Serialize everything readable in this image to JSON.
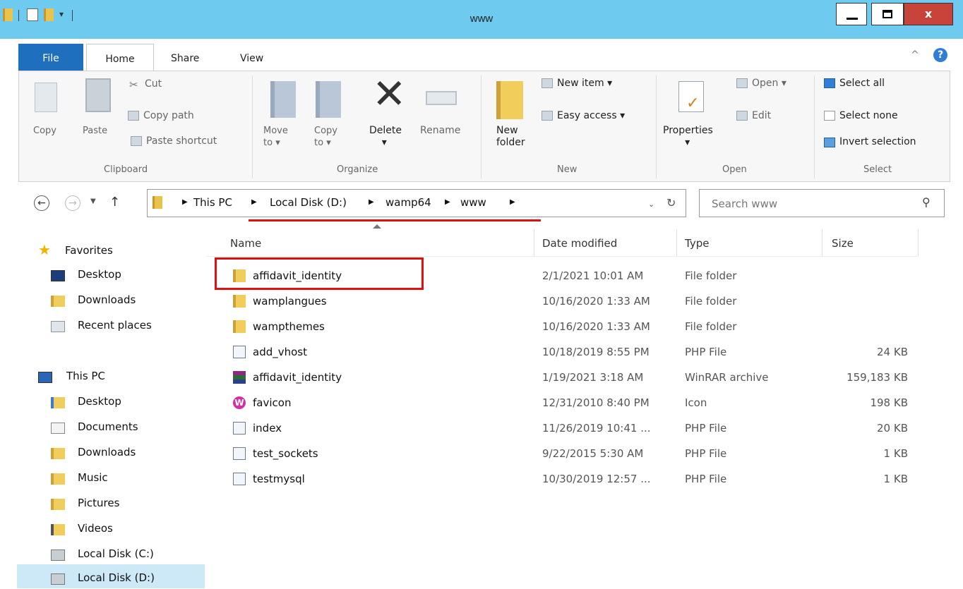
{
  "window": {
    "title": "www"
  },
  "title_controls": {
    "close": "x"
  },
  "tabs": [
    {
      "label": "File"
    },
    {
      "label": "Home"
    },
    {
      "label": "Share"
    },
    {
      "label": "View"
    }
  ],
  "ribbon": {
    "help_caret": "^",
    "help_icon": "?",
    "clipboard": {
      "label": "Clipboard",
      "copy": "Copy",
      "paste": "Paste",
      "cut": "Cut",
      "copy_path": "Copy path",
      "paste_shortcut": "Paste shortcut"
    },
    "organize": {
      "label": "Organize",
      "move_to_1": "Move",
      "move_to_2": "to",
      "copy_to_1": "Copy",
      "copy_to_2": "to",
      "delete": "Delete",
      "rename": "Rename"
    },
    "new": {
      "label": "New",
      "new_folder_1": "New",
      "new_folder_2": "folder",
      "new_item": "New item",
      "easy_access": "Easy access"
    },
    "open": {
      "label": "Open",
      "properties": "Properties",
      "open": "Open",
      "edit": "Edit"
    },
    "select": {
      "label": "Select",
      "select_all": "Select all",
      "select_none": "Select none",
      "invert_selection": "Invert selection"
    }
  },
  "address": {
    "crumbs": [
      "This PC",
      "Local Disk (D:)",
      "wamp64",
      "www"
    ],
    "search_placeholder": "Search www"
  },
  "nav_pane": {
    "favorites": "Favorites",
    "favorites_items": [
      "Desktop",
      "Downloads",
      "Recent places"
    ],
    "this_pc": "This PC",
    "this_pc_items": [
      "Desktop",
      "Documents",
      "Downloads",
      "Music",
      "Pictures",
      "Videos",
      "Local Disk (C:)",
      "Local Disk (D:)"
    ]
  },
  "file_list": {
    "columns": [
      "Name",
      "Date modified",
      "Type",
      "Size"
    ],
    "rows": [
      {
        "name": "affidavit_identity",
        "date": "2/1/2021 10:01 AM",
        "type": "File folder",
        "size": "",
        "icon": "folder"
      },
      {
        "name": "wamplangues",
        "date": "10/16/2020 1:33 AM",
        "type": "File folder",
        "size": "",
        "icon": "folder"
      },
      {
        "name": "wampthemes",
        "date": "10/16/2020 1:33 AM",
        "type": "File folder",
        "size": "",
        "icon": "folder"
      },
      {
        "name": "add_vhost",
        "date": "10/18/2019 8:55 PM",
        "type": "PHP File",
        "size": "24 KB",
        "icon": "php"
      },
      {
        "name": "affidavit_identity",
        "date": "1/19/2021 3:18 AM",
        "type": "WinRAR archive",
        "size": "159,183 KB",
        "icon": "rar"
      },
      {
        "name": "favicon",
        "date": "12/31/2010 8:40 PM",
        "type": "Icon",
        "size": "198 KB",
        "icon": "ico"
      },
      {
        "name": "index",
        "date": "11/26/2019 10:41 ...",
        "type": "PHP File",
        "size": "20 KB",
        "icon": "php"
      },
      {
        "name": "test_sockets",
        "date": "9/22/2015 5:30 AM",
        "type": "PHP File",
        "size": "1 KB",
        "icon": "php"
      },
      {
        "name": "testmysql",
        "date": "10/30/2019 12:57 ...",
        "type": "PHP File",
        "size": "1 KB",
        "icon": "php"
      }
    ]
  },
  "colors": {
    "titlebar": "#6fcaf0",
    "file_tab": "#1f6fbf",
    "close_button": "#c8433a",
    "annotation_red": "#e01010"
  }
}
